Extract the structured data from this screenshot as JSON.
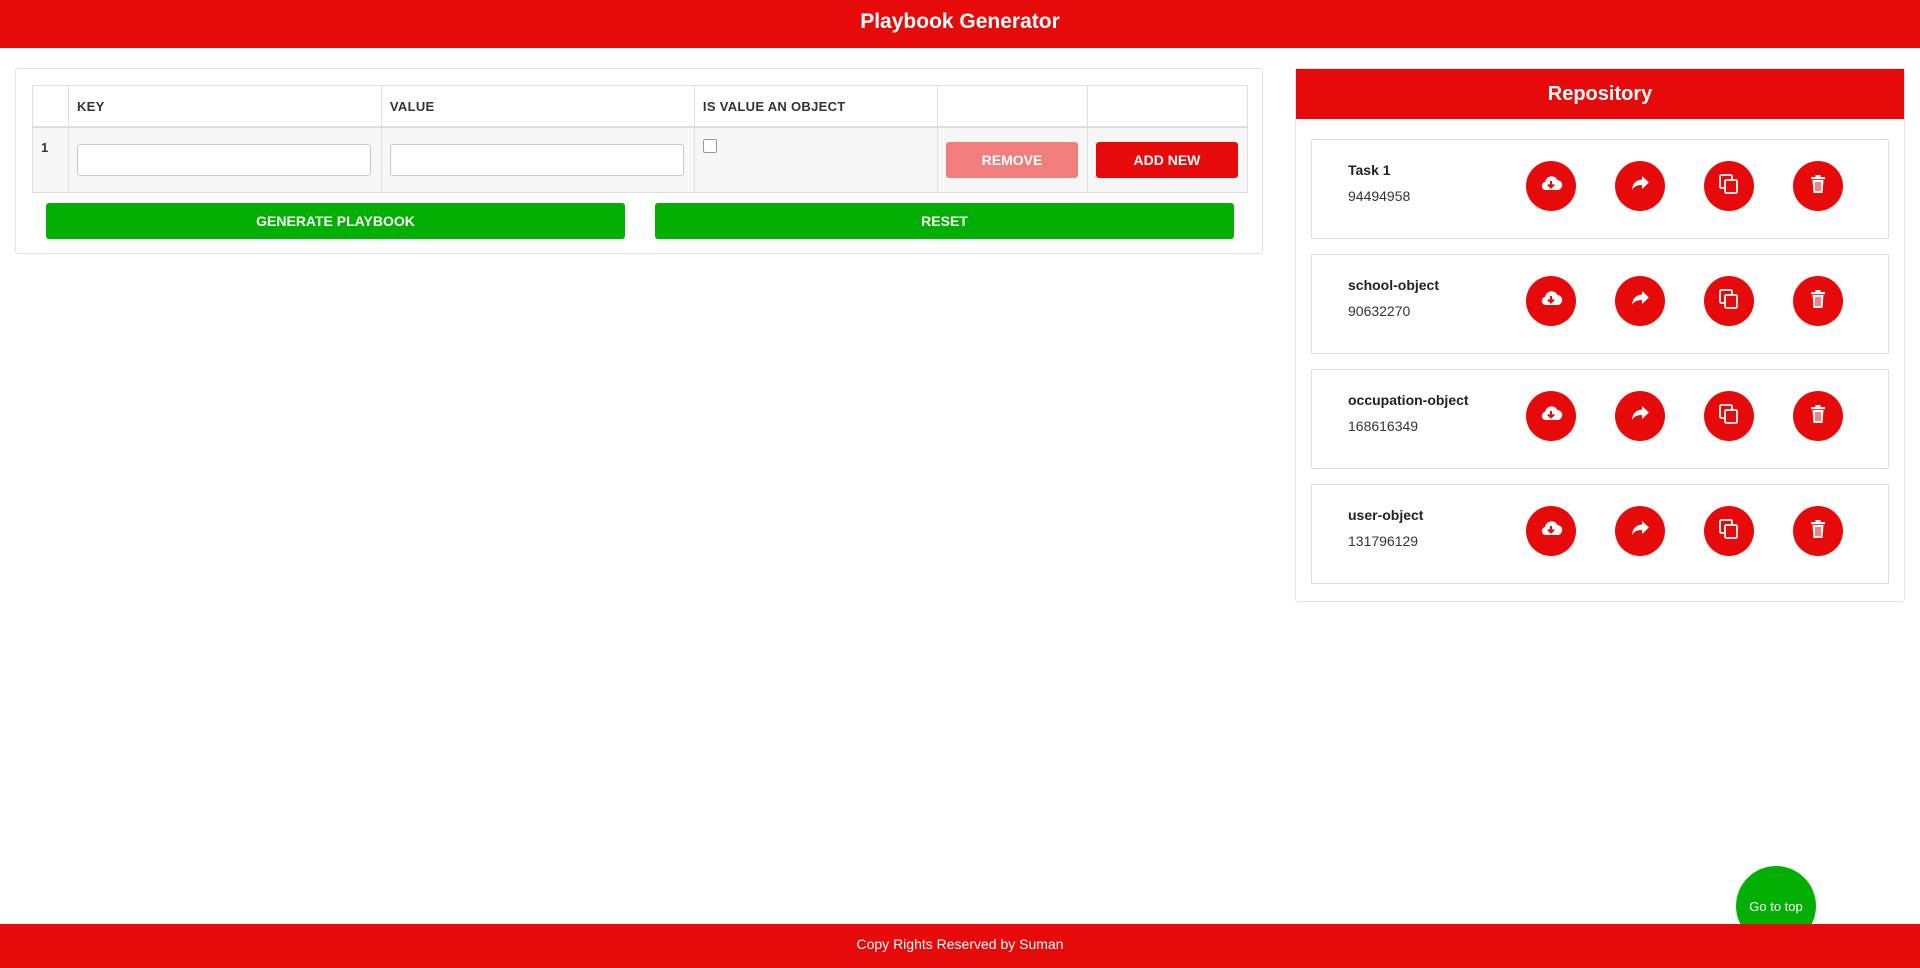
{
  "header": {
    "title": "Playbook Generator"
  },
  "table": {
    "columns": [
      "KEY",
      "VALUE",
      "IS VALUE AN OBJECT",
      "",
      ""
    ],
    "rows": [
      {
        "index": "1",
        "key": "",
        "value": "",
        "is_object": false
      }
    ],
    "remove_label": "REMOVE",
    "add_label": "ADD NEW"
  },
  "actions": {
    "generate_label": "GENERATE PLAYBOOK",
    "reset_label": "RESET"
  },
  "repository": {
    "title": "Repository",
    "items": [
      {
        "name": "Task 1",
        "id": "94494958"
      },
      {
        "name": "school-object",
        "id": "90632270"
      },
      {
        "name": "occupation-object",
        "id": "168616349"
      },
      {
        "name": "user-object",
        "id": "131796129"
      }
    ],
    "item_actions": [
      "cloud-download-icon",
      "share-icon",
      "copy-icon",
      "trash-icon"
    ]
  },
  "go_to_top_label": "Go to top",
  "footer": {
    "text": "Copy Rights Reserved by Suman"
  },
  "colors": {
    "primary": "#e70a0a",
    "success": "#04af04",
    "remove_disabled": "#f27d7d"
  }
}
